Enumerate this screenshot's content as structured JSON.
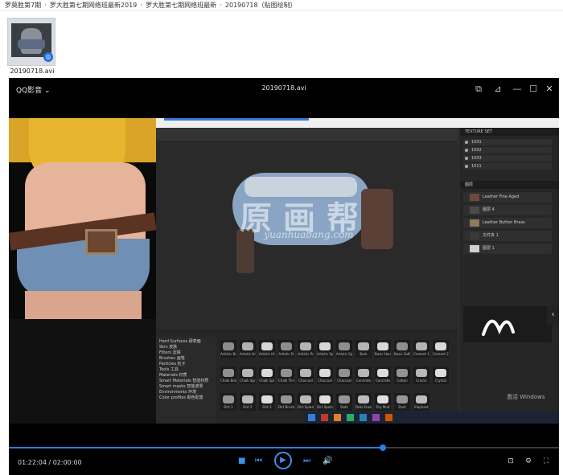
{
  "breadcrumb": [
    "罗莫胜第7期",
    "罗大胜第七期网络班最新2019",
    "罗大胜第七期网络班最新",
    "20190718（贴图绘制）"
  ],
  "file": {
    "name": "20190718.avi"
  },
  "player": {
    "brand": "QQ影音 ⌄",
    "title": "20190718.avi",
    "window_controls": [
      "pin-icon",
      "minimize-icon",
      "maximize-icon",
      "close-icon"
    ],
    "current_time": "01:22:04",
    "total_time": "02:00:00",
    "time_separator": " / ",
    "progress": 0.68
  },
  "substance": {
    "texture_sets": [
      "1001",
      "1002",
      "1003",
      "1011"
    ],
    "layers": [
      "Leather Fine Aged",
      "图层 4",
      "Leather Button Brass",
      "文件夹 1",
      "图层 1"
    ],
    "brush_categories": [
      "Hard Surfaces 硬表面",
      "Skin 皮肤",
      "Filters 滤镜",
      "Brushes 画笔",
      "Particles 粒子",
      "Tools 工具",
      "Materials 材质",
      "Smart Materials 智能材质",
      "Smart masks 智能遮罩",
      "Environments 环境",
      "Color profiles 颜色配置"
    ],
    "brushes": [
      "Artistic Br",
      "Artistic Hr",
      "Artistic Hr",
      "Artistic Pr",
      "Artistic Pr",
      "Artistic Sp",
      "Artistic Sp",
      "Bark",
      "Basic Hard",
      "Basic Soft",
      "Cement 1",
      "Cement 2",
      "Chalk Bold",
      "Chalk Spr",
      "Chalk Spr",
      "Chalk Thin",
      "Charcoal",
      "Charcoal",
      "Charcoal",
      "Concrete",
      "Concrete",
      "Cotton",
      "Cracks",
      "Crystal",
      "Dirt 1",
      "Dirt 2",
      "Dirt 3",
      "Dirt Brush",
      "Dirt Splash",
      "Dirt Spots",
      "Dots",
      "Dots Erased",
      "Dry Mud",
      "Dust",
      "Elephant"
    ],
    "watermark": "原画帮",
    "watermark_sub": "yuanhuabang.com",
    "windows_activate": "激活 Windows"
  },
  "icons": {
    "play": "play-icon",
    "stop": "stop-icon",
    "prev": "previous-icon",
    "next": "next-icon",
    "volume": "volume-icon"
  },
  "colors": {
    "accent": "#2a7de1",
    "player_bg": "#000000"
  }
}
